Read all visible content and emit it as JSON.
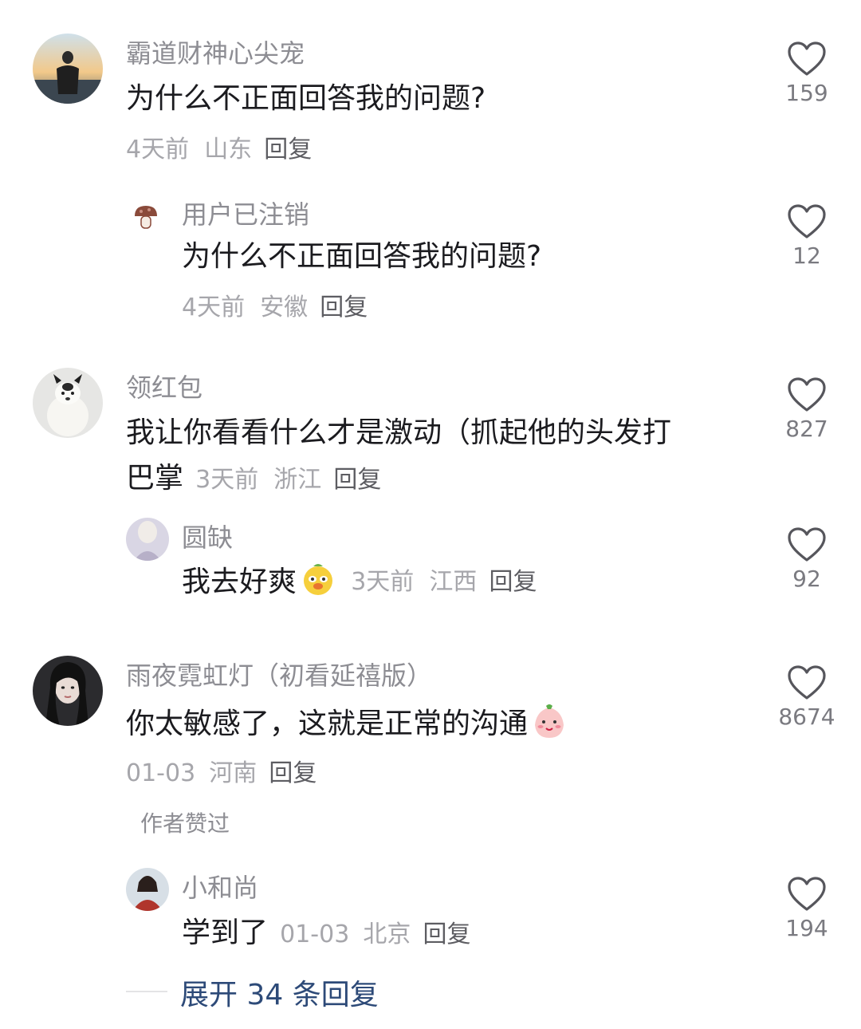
{
  "comments": [
    {
      "user": "霸道财神心尖宠",
      "text": "为什么不正面回答我的问题?",
      "time": "4天前",
      "location": "山东",
      "reply": "回复",
      "likes": "159"
    },
    {
      "user": "用户已注销",
      "text": "为什么不正面回答我的问题?",
      "time": "4天前",
      "location": "安徽",
      "reply": "回复",
      "likes": "12"
    },
    {
      "user": "领红包",
      "text_line1": "我让你看看什么才是激动（抓起他的头发打",
      "text_line2": "巴掌",
      "time": "3天前",
      "location": "浙江",
      "reply": "回复",
      "likes": "827"
    },
    {
      "user": "圆缺",
      "text": "我去好爽",
      "time": "3天前",
      "location": "江西",
      "reply": "回复",
      "likes": "92"
    },
    {
      "user": "雨夜霓虹灯（初看延禧版）",
      "text": "你太敏感了，这就是正常的沟通",
      "time": "01-03",
      "location": "河南",
      "reply": "回复",
      "likes": "8674",
      "badge": "作者赞过"
    },
    {
      "user": "小和尚",
      "text": "学到了",
      "time": "01-03",
      "location": "北京",
      "reply": "回复",
      "likes": "194"
    }
  ],
  "expand_replies": "展开 34 条回复",
  "icons": {
    "like": "heart-outline-icon",
    "mushroom": "mushroom-icon",
    "emoji_dog": "dog-emoji-icon",
    "emoji_peach": "peach-emoji-icon"
  },
  "colors": {
    "username": "#8d8d93",
    "text": "#1b1b1f",
    "meta": "#a6a6ab",
    "link": "#2d4a78"
  }
}
